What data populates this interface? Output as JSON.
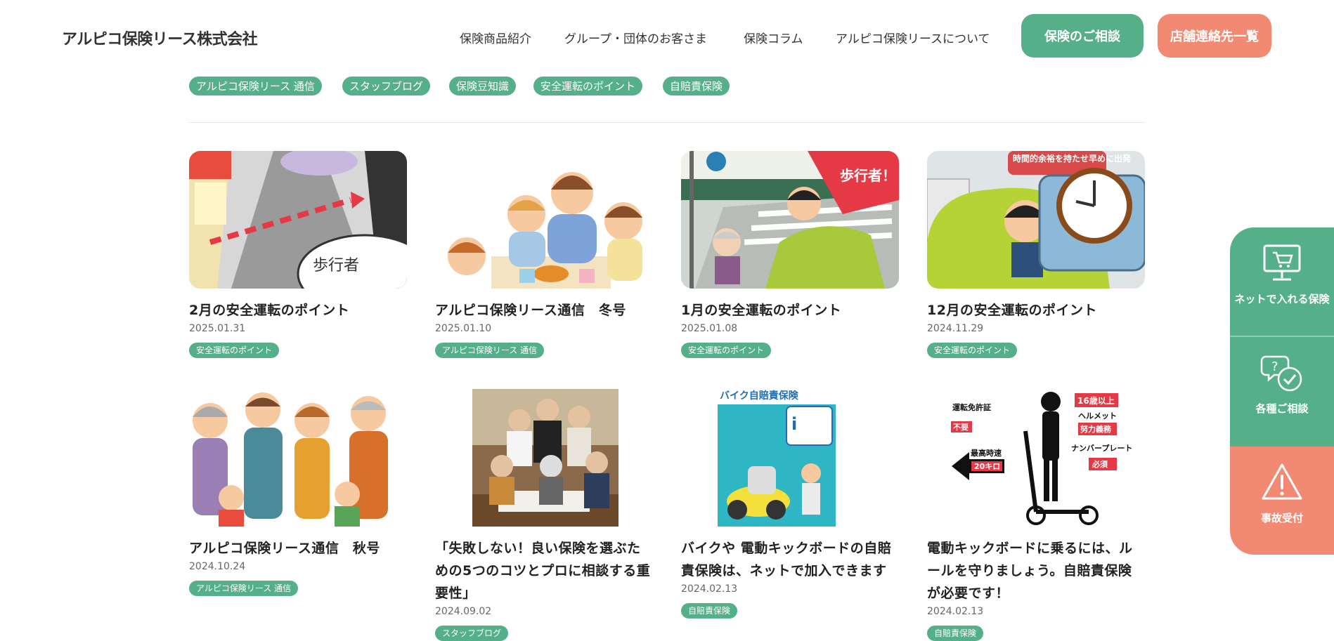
{
  "header": {
    "logo": "アルピコ保険リース株式会社",
    "nav": [
      "保険商品紹介",
      "グループ・団体のお客さま",
      "保険コラム",
      "アルピコ保険リースについて"
    ],
    "consult_button": "保険のご相談",
    "stores_button": "店舗連絡先一覧"
  },
  "categories": [
    "アルピコ保険リース 通信",
    "スタッフブログ",
    "保険豆知識",
    "安全運転のポイント",
    "自賠責保険"
  ],
  "posts": [
    {
      "title": "2月の安全運転のポイント",
      "date": "2025.01.31",
      "tag": "安全運転のポイント",
      "image_text": "歩行者"
    },
    {
      "title": "アルピコ保険リース通信　冬号",
      "date": "2025.01.10",
      "tag": "アルピコ保険リース 通信"
    },
    {
      "title": "1月の安全運転のポイント",
      "date": "2025.01.08",
      "tag": "安全運転のポイント",
      "image_text": "歩行者！"
    },
    {
      "title": "12月の安全運転のポイント",
      "date": "2024.11.29",
      "tag": "安全運転のポイント",
      "image_text": "時間的余裕を持たせ早めに出発"
    },
    {
      "title": "アルピコ保険リース通信　秋号",
      "date": "2024.10.24",
      "tag": "アルピコ保険リース 通信"
    },
    {
      "title": "「失敗しない！良い保険を選ぶための5つのコツとプロに相談する重要性」",
      "date": "2024.09.02",
      "tag": "スタッフブログ"
    },
    {
      "title": "バイクや 電動キックボードの自賠責保険は、ネットで加入できます",
      "date": "2024.02.13",
      "tag": "自賠責保険",
      "image_text": "バイク自賠責保険"
    },
    {
      "title": "電動キックボードに乗るには、ルールを守りましょう。自賠責保険が必要です！",
      "date": "2024.02.13",
      "tag": "自賠責保険",
      "image_text": [
        "16歳以上",
        "運転免許証",
        "不要",
        "ヘルメット",
        "努力義務",
        "最高時速",
        "20キロ",
        "ナンバープレート",
        "必須"
      ]
    }
  ],
  "side_panel": [
    {
      "label": "ネットで入れる保険",
      "icon": "cart-monitor-icon",
      "color": "#55b08a"
    },
    {
      "label": "各種ご相談",
      "icon": "consult-bubble-icon",
      "color": "#55b08a"
    },
    {
      "label": "事故受付",
      "icon": "warning-icon",
      "color": "#f28a73"
    }
  ],
  "colors": {
    "accent": "#55b08a",
    "accent_secondary": "#f28a73"
  }
}
